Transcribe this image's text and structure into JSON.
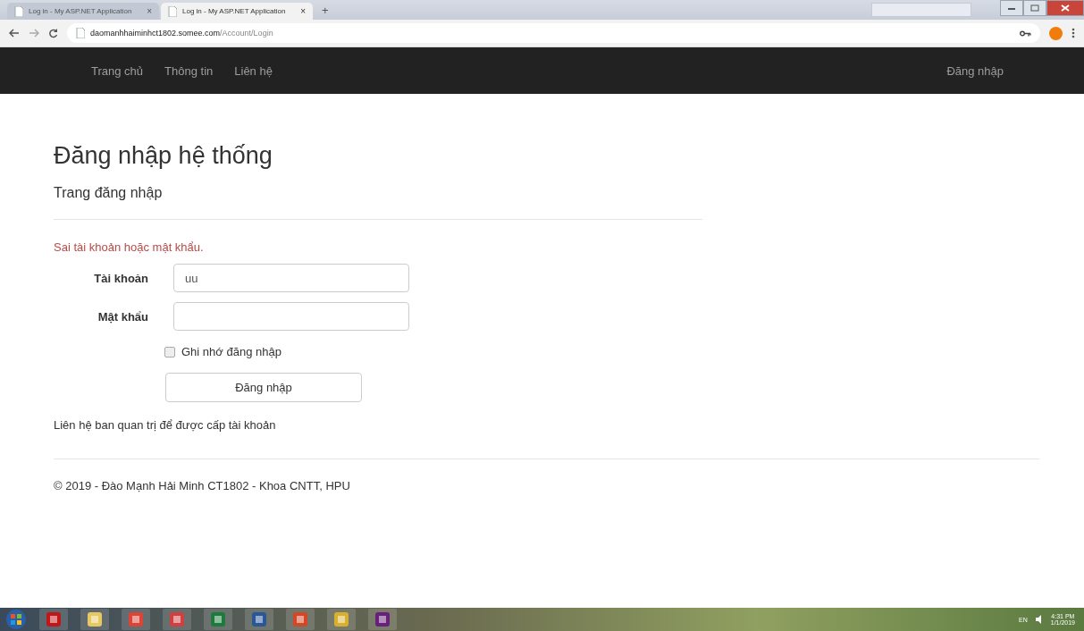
{
  "browser": {
    "tabs": [
      {
        "title": "Log in - My ASP.NET Application",
        "close": "×",
        "selected": false
      },
      {
        "title": "Log in - My ASP.NET Application",
        "close": "×",
        "selected": true
      }
    ],
    "new_tab": "+",
    "address": {
      "host": "daomanhhaiminhct1802.somee.com",
      "path": "/Account/Login"
    }
  },
  "navbar": {
    "links": [
      "Trang chủ",
      "Thông tin",
      "Liên hệ"
    ],
    "login": "Đăng nhập"
  },
  "page": {
    "title": "Đăng nhập hệ thống",
    "subtitle": "Trang đăng nhập",
    "error": "Sai tài khoản hoặc mật khẩu.",
    "fields": [
      {
        "label": "Tài khoản",
        "value": "uu",
        "kind": "text"
      },
      {
        "label": "Mật khẩu",
        "kind": "password"
      }
    ],
    "remember": {
      "label": "Ghi nhớ đăng nhập",
      "checked": false
    },
    "submit": "Đăng nhập",
    "note": "Liên hệ ban quan trị để được cấp tài khoản",
    "footer": "© 2019 - Đào Mạnh Hải Minh CT1802 - Khoa CNTT, HPU"
  },
  "taskbar": {
    "apps": [
      {
        "color": "#c01818"
      },
      {
        "color": "#e8c860"
      },
      {
        "color": "#db4437"
      },
      {
        "color": "#d04040"
      },
      {
        "color": "#1d7a3c"
      },
      {
        "color": "#2b5797"
      },
      {
        "color": "#d24726"
      },
      {
        "color": "#d8b030"
      },
      {
        "color": "#68217a"
      }
    ],
    "language": "EN",
    "time": "4:31 PM",
    "date": "1/1/2019"
  }
}
